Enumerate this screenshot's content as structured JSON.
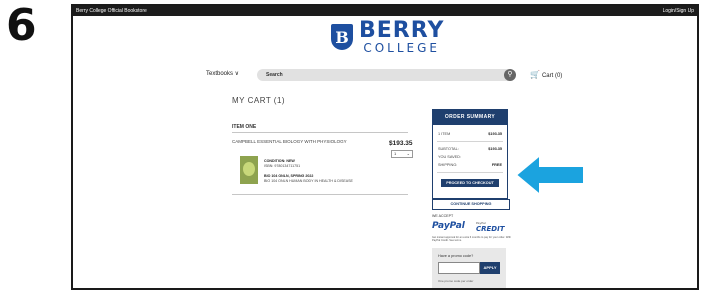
{
  "step_number": "6",
  "topbar": {
    "site_name": "Berry College Official Bookstore",
    "login": "Login/Sign Up"
  },
  "logo": {
    "letter": "B",
    "berry": "BERRY",
    "college": "COLLEGE"
  },
  "nav": {
    "textbooks": "Textbooks ∨",
    "search_placeholder": "Search",
    "cart": "Cart (0)"
  },
  "cart": {
    "title": "MY CART (1)",
    "item_heading": "ITEM ONE",
    "product_title": "CAMPBELL ESSENTIAL BIOLOGY WITH PHYSIOLOGY",
    "price": "$193.35",
    "quantity": "1",
    "condition": "CONDITION: NEW",
    "isbn": "ISBN: 9780134711751",
    "course_code": "BIO 104 ONLN, SPRING 2022",
    "course_name": "BIO 104 ONLN HUMAN BODY IN HEALTH & DISEASE"
  },
  "summary": {
    "heading": "ORDER SUMMARY",
    "items_label": "1 ITEM",
    "items_value": "$193.35",
    "subtotal_label": "SUBTOTAL:",
    "subtotal_value": "$193.35",
    "saved_label": "YOU SAVED:",
    "shipping_label": "SHIPPING:",
    "shipping_value": "FREE",
    "checkout": "PROCEED TO CHECKOUT"
  },
  "continue_shopping": "CONTINUE SHOPPING",
  "payments": {
    "we_accept": "WE ACCEPT",
    "paypal": "PayPal",
    "paypal_credit": "CREDIT",
    "paypal_credit_small": "PayPal",
    "note": "Get instant approval for an extra 6 months to pay for your order. With PayPal Credit. See terms."
  },
  "promo": {
    "label": "Have a promo code?",
    "apply": "APPLY",
    "note": "One promo code per order"
  },
  "colors": {
    "brand": "#1e4fa0",
    "navy": "#1f3f6e",
    "arrow": "#1ba3df"
  }
}
